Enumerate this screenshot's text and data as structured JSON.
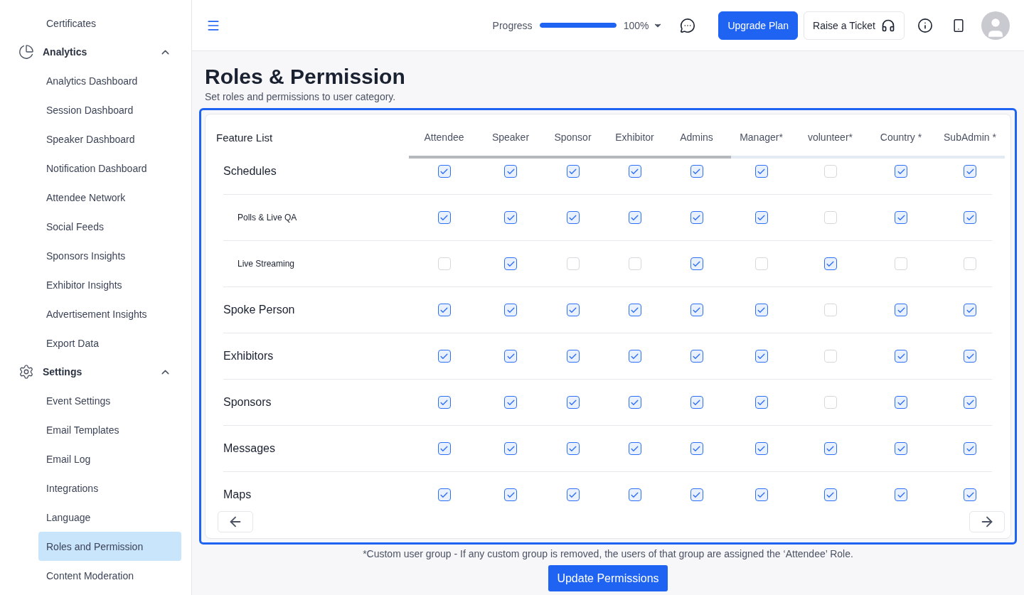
{
  "sidebar": {
    "items": [
      {
        "kind": "link",
        "label": "Certificates",
        "selected": false
      },
      {
        "kind": "group",
        "label": "Analytics",
        "expanded": true,
        "children": [
          {
            "label": "Analytics Dashboard",
            "selected": false
          },
          {
            "label": "Session Dashboard",
            "selected": false
          },
          {
            "label": "Speaker Dashboard",
            "selected": false
          },
          {
            "label": "Notification Dashboard",
            "selected": false
          },
          {
            "label": "Attendee Network",
            "selected": false
          },
          {
            "label": "Social Feeds",
            "selected": false
          },
          {
            "label": "Sponsors Insights",
            "selected": false
          },
          {
            "label": "Exhibitor Insights",
            "selected": false
          },
          {
            "label": "Advertisement Insights",
            "selected": false
          },
          {
            "label": "Export Data",
            "selected": false
          }
        ]
      },
      {
        "kind": "group",
        "label": "Settings",
        "expanded": true,
        "children": [
          {
            "label": "Event Settings",
            "selected": false
          },
          {
            "label": "Email Templates",
            "selected": false
          },
          {
            "label": "Email Log",
            "selected": false
          },
          {
            "label": "Integrations",
            "selected": false
          },
          {
            "label": "Language",
            "selected": false
          },
          {
            "label": "Roles and Permission",
            "selected": true
          },
          {
            "label": "Content Moderation",
            "selected": false
          }
        ]
      }
    ]
  },
  "header": {
    "progress": {
      "label": "Progress",
      "level": 1,
      "reading": "100%"
    },
    "upgrade_button": "Upgrade Plan",
    "ticket_button": "Raise a Ticket"
  },
  "page": {
    "title": "Roles & Permission",
    "subtitle": "Set roles and permissions to user category."
  },
  "table": {
    "feature_heading": "Feature List",
    "columns": [
      "Attendee",
      "Speaker",
      "Sponsor",
      "Exhibitor",
      "Admins",
      "Manager*",
      "volunteer*",
      "Country *",
      "SubAdmin *"
    ],
    "rows": [
      {
        "name": "Schedules",
        "kind": "feature",
        "checks": [
          true,
          true,
          true,
          true,
          true,
          true,
          false,
          true,
          true
        ]
      },
      {
        "name": "Polls & Live QA",
        "kind": "sub",
        "checks": [
          true,
          true,
          true,
          true,
          true,
          true,
          false,
          true,
          true
        ]
      },
      {
        "name": "Live Streaming",
        "kind": "sub",
        "checks": [
          false,
          true,
          false,
          false,
          true,
          false,
          true,
          false,
          false
        ]
      },
      {
        "name": "Spoke Person",
        "kind": "feature",
        "checks": [
          true,
          true,
          true,
          true,
          true,
          true,
          false,
          true,
          true
        ]
      },
      {
        "name": "Exhibitors",
        "kind": "feature",
        "checks": [
          true,
          true,
          true,
          true,
          true,
          true,
          false,
          true,
          true
        ]
      },
      {
        "name": "Sponsors",
        "kind": "feature",
        "checks": [
          true,
          true,
          true,
          true,
          true,
          true,
          false,
          true,
          true
        ]
      },
      {
        "name": "Messages",
        "kind": "feature",
        "checks": [
          true,
          true,
          true,
          true,
          true,
          true,
          true,
          true,
          true
        ]
      },
      {
        "name": "Maps",
        "kind": "feature",
        "checks": [
          true,
          true,
          true,
          true,
          true,
          true,
          true,
          true,
          true
        ]
      }
    ]
  },
  "footnote": "*Custom user group - If any custom group is removed, the users of that group are assigned the ‘Attendee’ Role.",
  "update_button": "Update Permissions"
}
